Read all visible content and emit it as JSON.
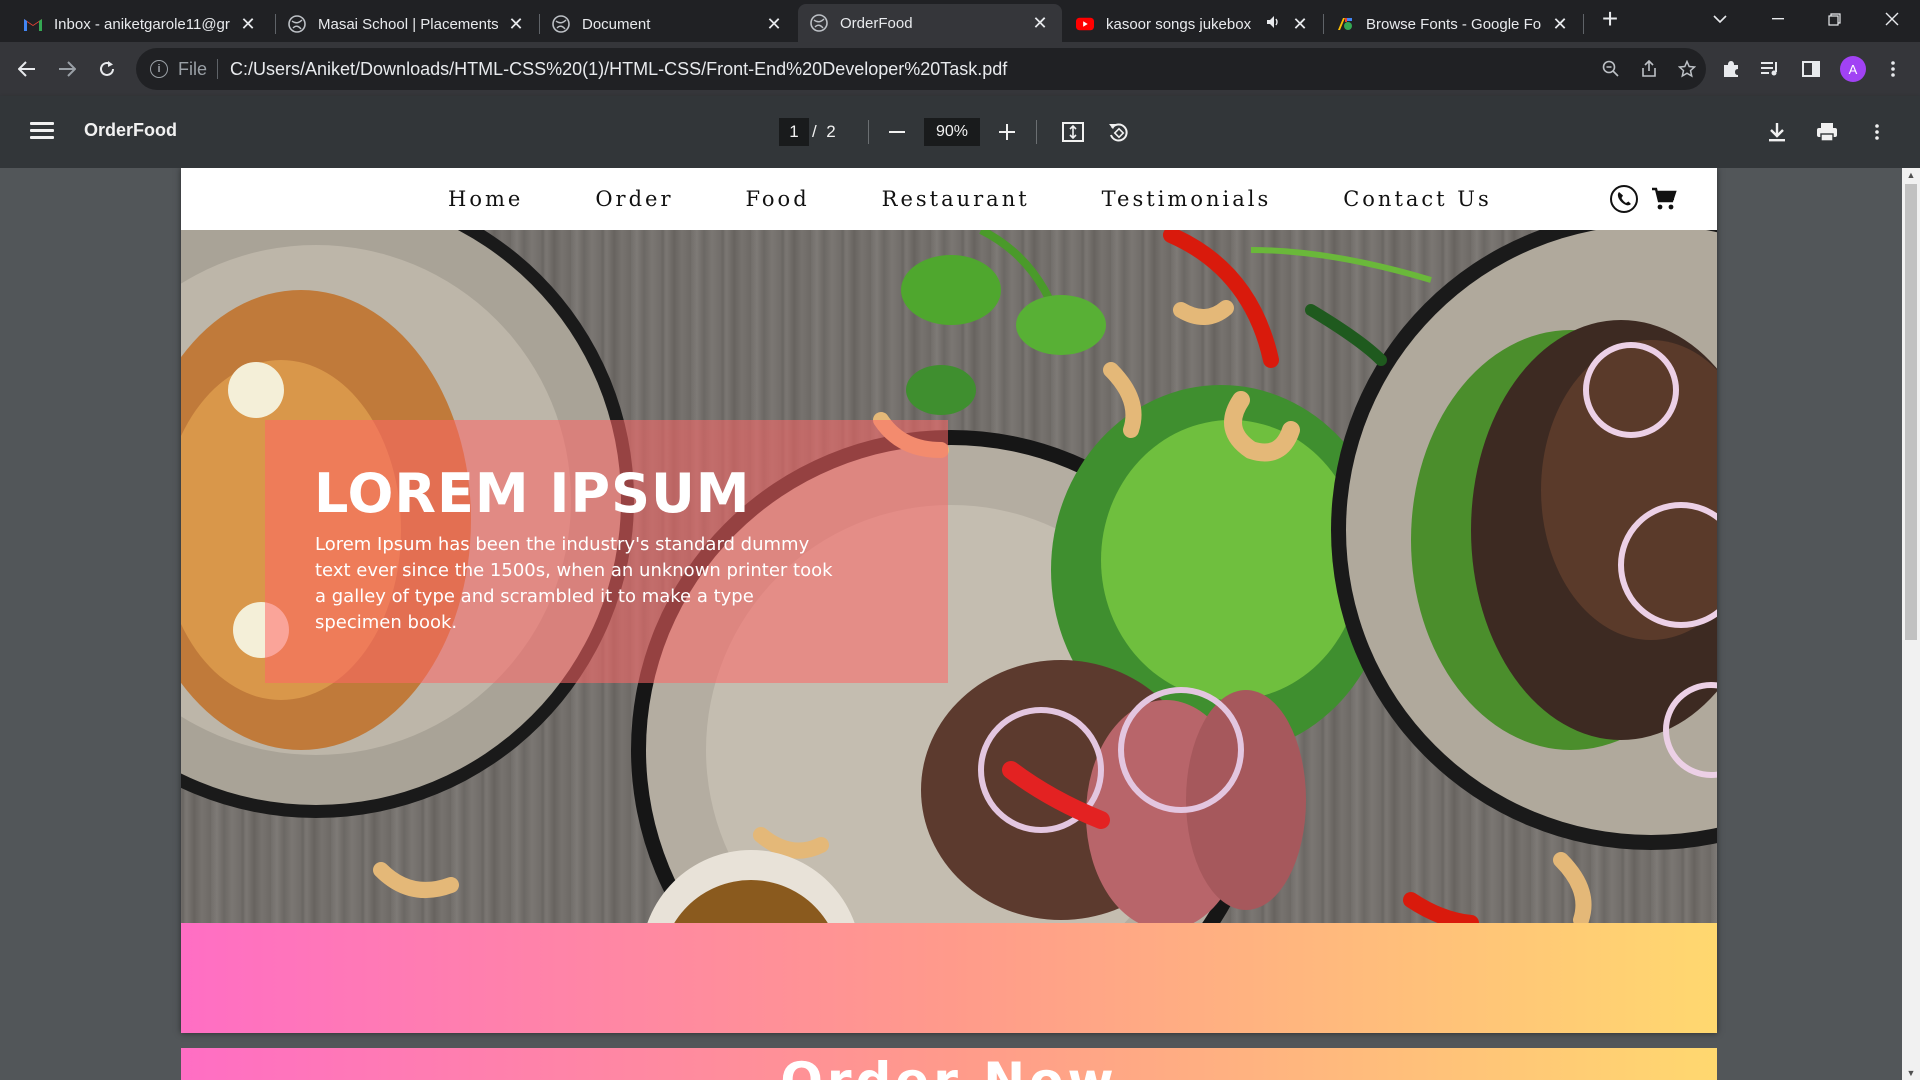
{
  "browser": {
    "tabs": [
      {
        "title": "Inbox - aniketgarole11@gr",
        "icon": "gmail-icon",
        "active": false
      },
      {
        "title": "Masai School | Placements",
        "icon": "globe-icon",
        "active": false
      },
      {
        "title": "Document",
        "icon": "globe-icon",
        "active": false
      },
      {
        "title": "OrderFood",
        "icon": "globe-icon",
        "active": true
      },
      {
        "title": "kasoor songs jukebox",
        "icon": "youtube-icon",
        "active": false,
        "audio": true
      },
      {
        "title": "Browse Fonts - Google For",
        "icon": "google-fonts-icon",
        "active": false
      }
    ],
    "new_tab_label": "+",
    "address": {
      "scheme": "File",
      "url": "C:/Users/Aniket/Downloads/HTML-CSS%20(1)/HTML-CSS/Front-End%20Developer%20Task.pdf"
    },
    "profile_initial": "A"
  },
  "pdf_viewer": {
    "title": "OrderFood",
    "current_page": "1",
    "page_separator": "/",
    "total_pages": "2",
    "zoom": "90%"
  },
  "site": {
    "nav": {
      "links": [
        "Home",
        "Order",
        "Food",
        "Restaurant",
        "Testimonials",
        "Contact Us"
      ]
    },
    "hero": {
      "title": "LOREM IPSUM",
      "text": "Lorem Ipsum has been the industry's standard dummy text ever since the 1500s, when an unknown printer took a galley of type and scrambled it to make a type specimen book."
    },
    "gradient_colors": [
      "#ff6ec4",
      "#ff9a8b",
      "#ffd86f"
    ],
    "next_section_heading": "Order Now"
  }
}
